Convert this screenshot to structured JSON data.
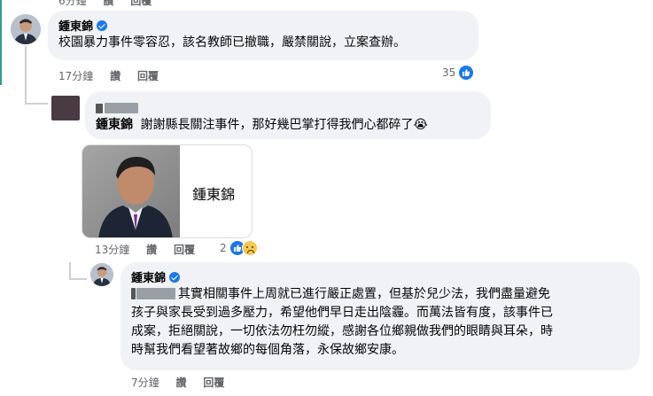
{
  "top_partial": {
    "time": "6分鐘",
    "like": "讚",
    "reply": "回覆"
  },
  "comment1": {
    "author": "鍾東錦",
    "text": "校園暴力事件零容忍，該名教師已撤職，嚴禁關說，立案查辦。",
    "time": "17分鐘",
    "like": "讚",
    "reply": "回覆",
    "reaction_count": "35",
    "reaction_icon": "like-icon"
  },
  "comment2": {
    "mention": "鍾東錦",
    "text": "謝謝縣長關注事件，那好幾巴掌打得我們心都碎了",
    "emoji": "😭",
    "card_label": "鍾東錦",
    "time": "13分鐘",
    "like": "讚",
    "reply": "回覆",
    "reaction_count": "2",
    "reaction_icons": [
      "like-icon",
      "sad-icon"
    ]
  },
  "comment3": {
    "author": "鍾東錦",
    "text_line1": "其實相關事件上周就已進行嚴正處置，但基於兒少法，我們盡量避免",
    "text_line2": "孩子與家長受到過多壓力，希望他們早日走出陰霾。而萬法皆有度，該事件已",
    "text_line3": "成案，拒絕關說，一切依法勿枉勿縱，感謝各位鄉親做我們的眼睛與耳朵，時",
    "text_line4": "時幫我們看望著故鄉的每個角落，永保故鄉安康。",
    "time": "7分鐘",
    "like": "讚",
    "reply": "回覆"
  },
  "colors": {
    "accent": "#1877f2",
    "bubble": "#f0f2f5",
    "meta": "#65676b"
  }
}
